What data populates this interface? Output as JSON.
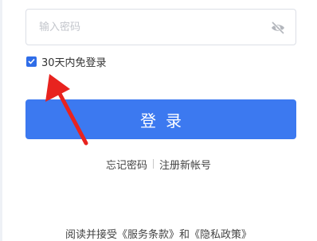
{
  "password": {
    "placeholder": "输入密码",
    "value": "",
    "toggle_icon": "eye-slash-icon"
  },
  "remember": {
    "label": "30天内免登录",
    "checked": true
  },
  "login_button": {
    "label": "登录"
  },
  "links": {
    "forgot_password": "忘记密码",
    "register": "注册新帐号"
  },
  "terms": {
    "prefix": "阅读并接受",
    "service_terms": "《服务条款》",
    "conjunction": "和",
    "privacy_policy": "《隐私政策》"
  },
  "colors": {
    "primary": "#3c79f0",
    "checkbox": "#2f6de8",
    "annotation_arrow": "#e8231f"
  }
}
